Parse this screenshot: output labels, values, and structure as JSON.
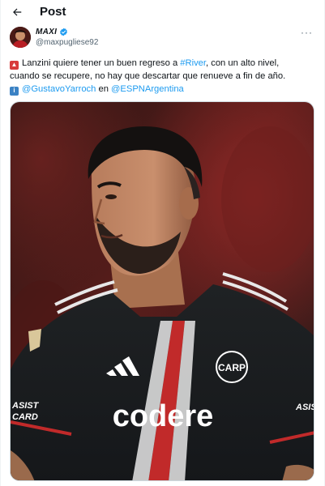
{
  "header": {
    "title": "Post",
    "back_icon": "arrow-left-icon"
  },
  "author": {
    "name": "MAXI",
    "handle": "@maxpugliese92",
    "verified_icon": "verified-badge-icon",
    "more_icon": "more-horizontal-icon",
    "more_glyph": "···"
  },
  "tweet": {
    "emoji_1": "siren-emoji",
    "line1_pre": "Lanzini quiere tener un buen regreso a ",
    "hashtag": "#River",
    "line1_post": ", con un alto nivel,",
    "line2": "cuando se recupere, no hay que descartar que renueve a fin de año.",
    "emoji_2": "info-emoji",
    "emoji_2_glyph": "i",
    "mention_1": "@GustavoYarroch",
    "connector": " en ",
    "mention_2": "@ESPNArgentina"
  },
  "media": {
    "jersey_sponsor": "codere",
    "jersey_crest": "CARP",
    "sleeve_text_left": "ASIST CARD",
    "sleeve_text_right": "ASIS"
  },
  "colors": {
    "accent": "#1d9bf0",
    "text": "#0f1419",
    "muted": "#536471",
    "verified": "#1d9bf0"
  }
}
